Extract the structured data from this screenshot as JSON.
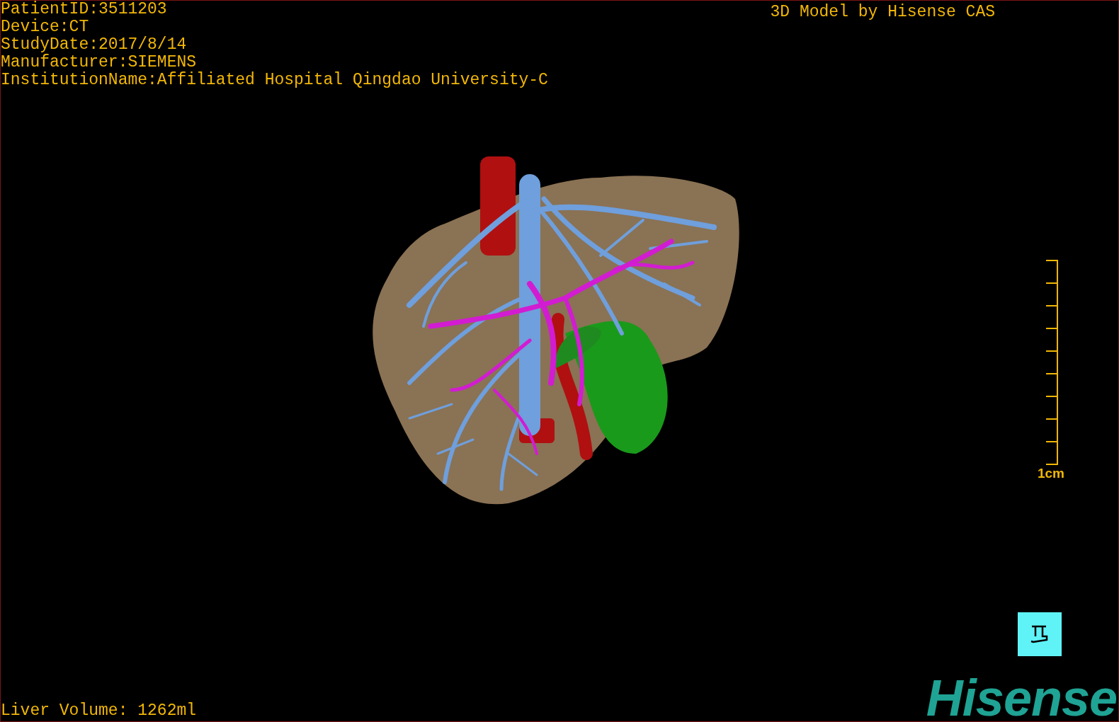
{
  "study_info": [
    "PatientID:3511203",
    "Device:CT",
    "StudyDate:2017/8/14",
    "Manufacturer:SIEMENS",
    "InstitutionName:Affiliated Hospital Qingdao University-C"
  ],
  "title": "3D Model by Hisense CAS",
  "scale_bar": {
    "label": "1cm"
  },
  "liver_volume": "Liver Volume: 1262ml",
  "logo": "Hisense"
}
